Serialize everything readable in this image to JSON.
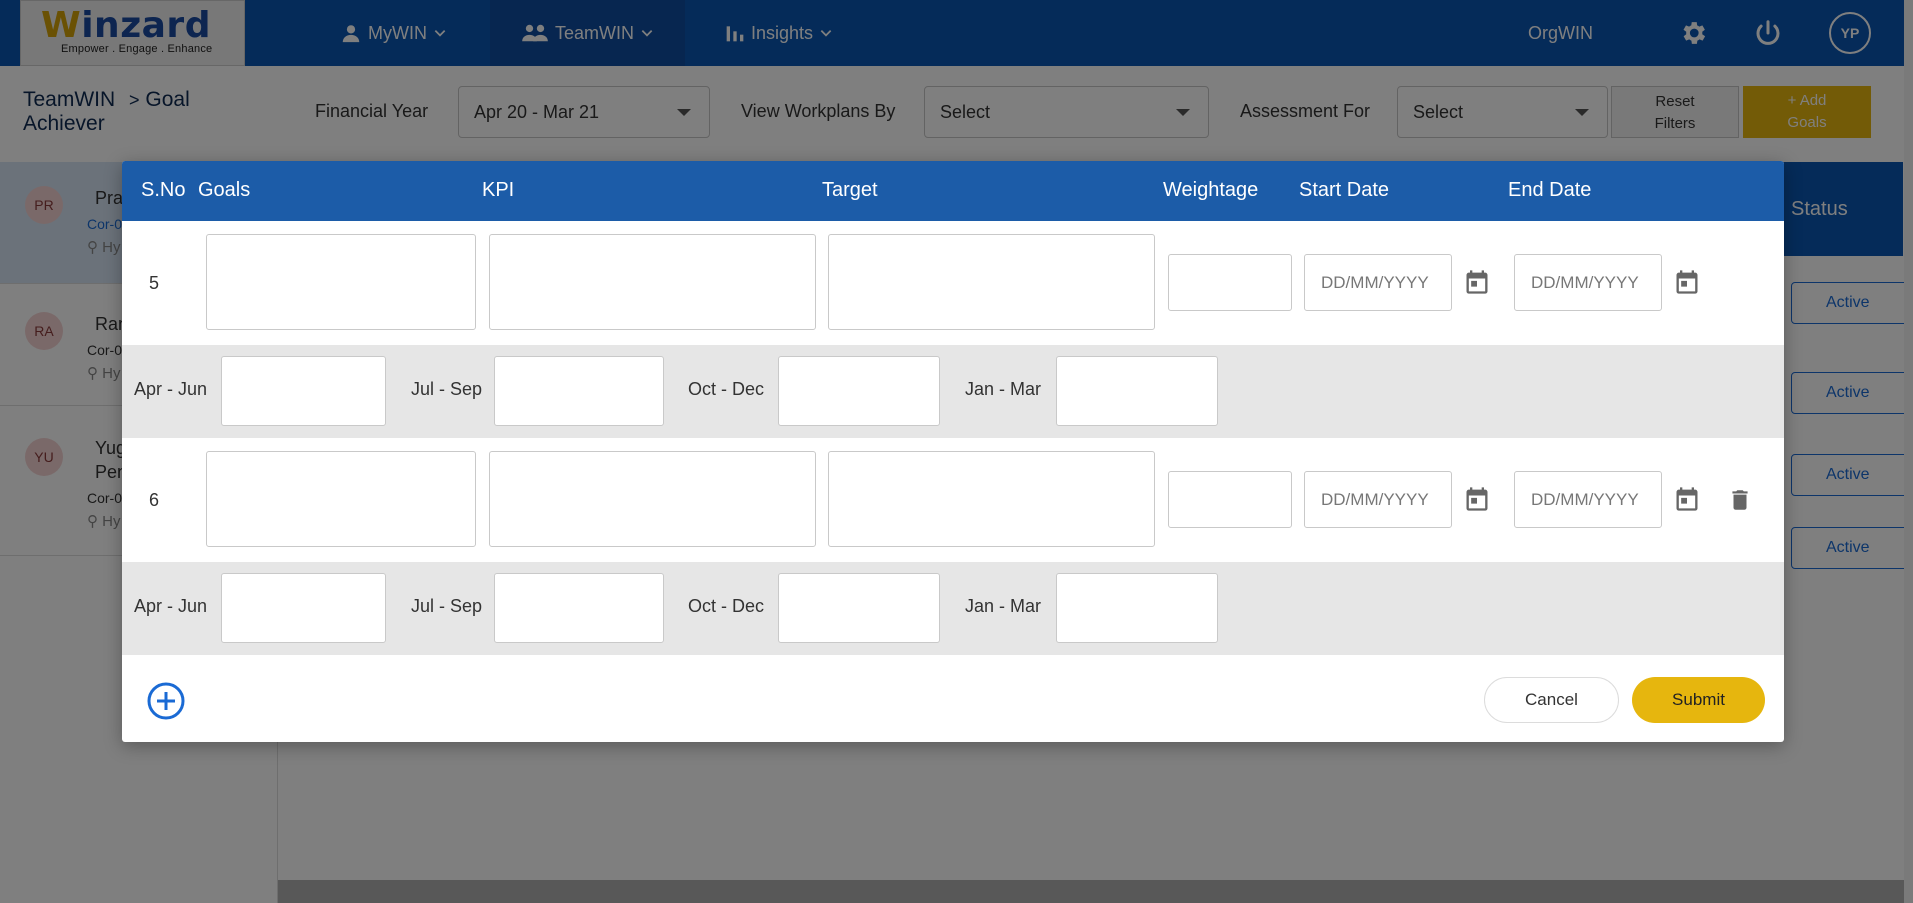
{
  "brand": {
    "name": "Winzard",
    "name_first": "W",
    "name_rest": "inzard",
    "tagline": "Empower . Engage . Enhance"
  },
  "nav": {
    "items": [
      {
        "label": "MyWIN",
        "icon": "person-icon"
      },
      {
        "label": "TeamWIN",
        "icon": "group-icon",
        "active": true
      },
      {
        "label": "Insights",
        "icon": "bar-chart-icon"
      }
    ],
    "orgwin": "OrgWIN",
    "user_initials": "YP"
  },
  "breadcrumb": {
    "root": "TeamWIN",
    "separator": ">",
    "current_line1": "Goal",
    "current_line2": "Achiever"
  },
  "filters": {
    "financial_year_label": "Financial Year",
    "financial_year_value": "Apr 20 - Mar 21",
    "view_workplans_label": "View Workplans By",
    "view_workplans_value": "Select",
    "assessment_label": "Assessment For",
    "assessment_value": "Select",
    "reset_line1": "Reset",
    "reset_line2": "Filters",
    "add_line1": "+ Add",
    "add_line2": "Goals"
  },
  "people": [
    {
      "initials": "PR",
      "name": "Pra",
      "sub": "Cor-0",
      "loc": "Hy"
    },
    {
      "initials": "RA",
      "name": "Ran",
      "sub": "Cor-0",
      "loc": "Hy"
    },
    {
      "initials": "YU",
      "name": "Yug",
      "name2": "Pen",
      "sub": "Cor-0",
      "loc": "Hy"
    }
  ],
  "table": {
    "status_header": "Status",
    "status_values": [
      "Active",
      "Active",
      "Active",
      "Active"
    ]
  },
  "modal": {
    "headers": {
      "sno": "S.No",
      "goals": "Goals",
      "kpi": "KPI",
      "target": "Target",
      "weightage": "Weightage",
      "start_date": "Start Date",
      "end_date": "End Date"
    },
    "date_placeholder": "DD/MM/YYYY",
    "quarters": [
      "Apr - Jun",
      "Jul - Sep",
      "Oct - Dec",
      "Jan - Mar"
    ],
    "rows": [
      {
        "sno": "5"
      },
      {
        "sno": "6"
      }
    ],
    "cancel_label": "Cancel",
    "submit_label": "Submit"
  },
  "colors": {
    "nav_bg": "#0b57b3",
    "modal_header": "#1c5ca8",
    "accent_yellow": "#e6b60e",
    "quarter_row_bg": "#e6e6e6"
  }
}
